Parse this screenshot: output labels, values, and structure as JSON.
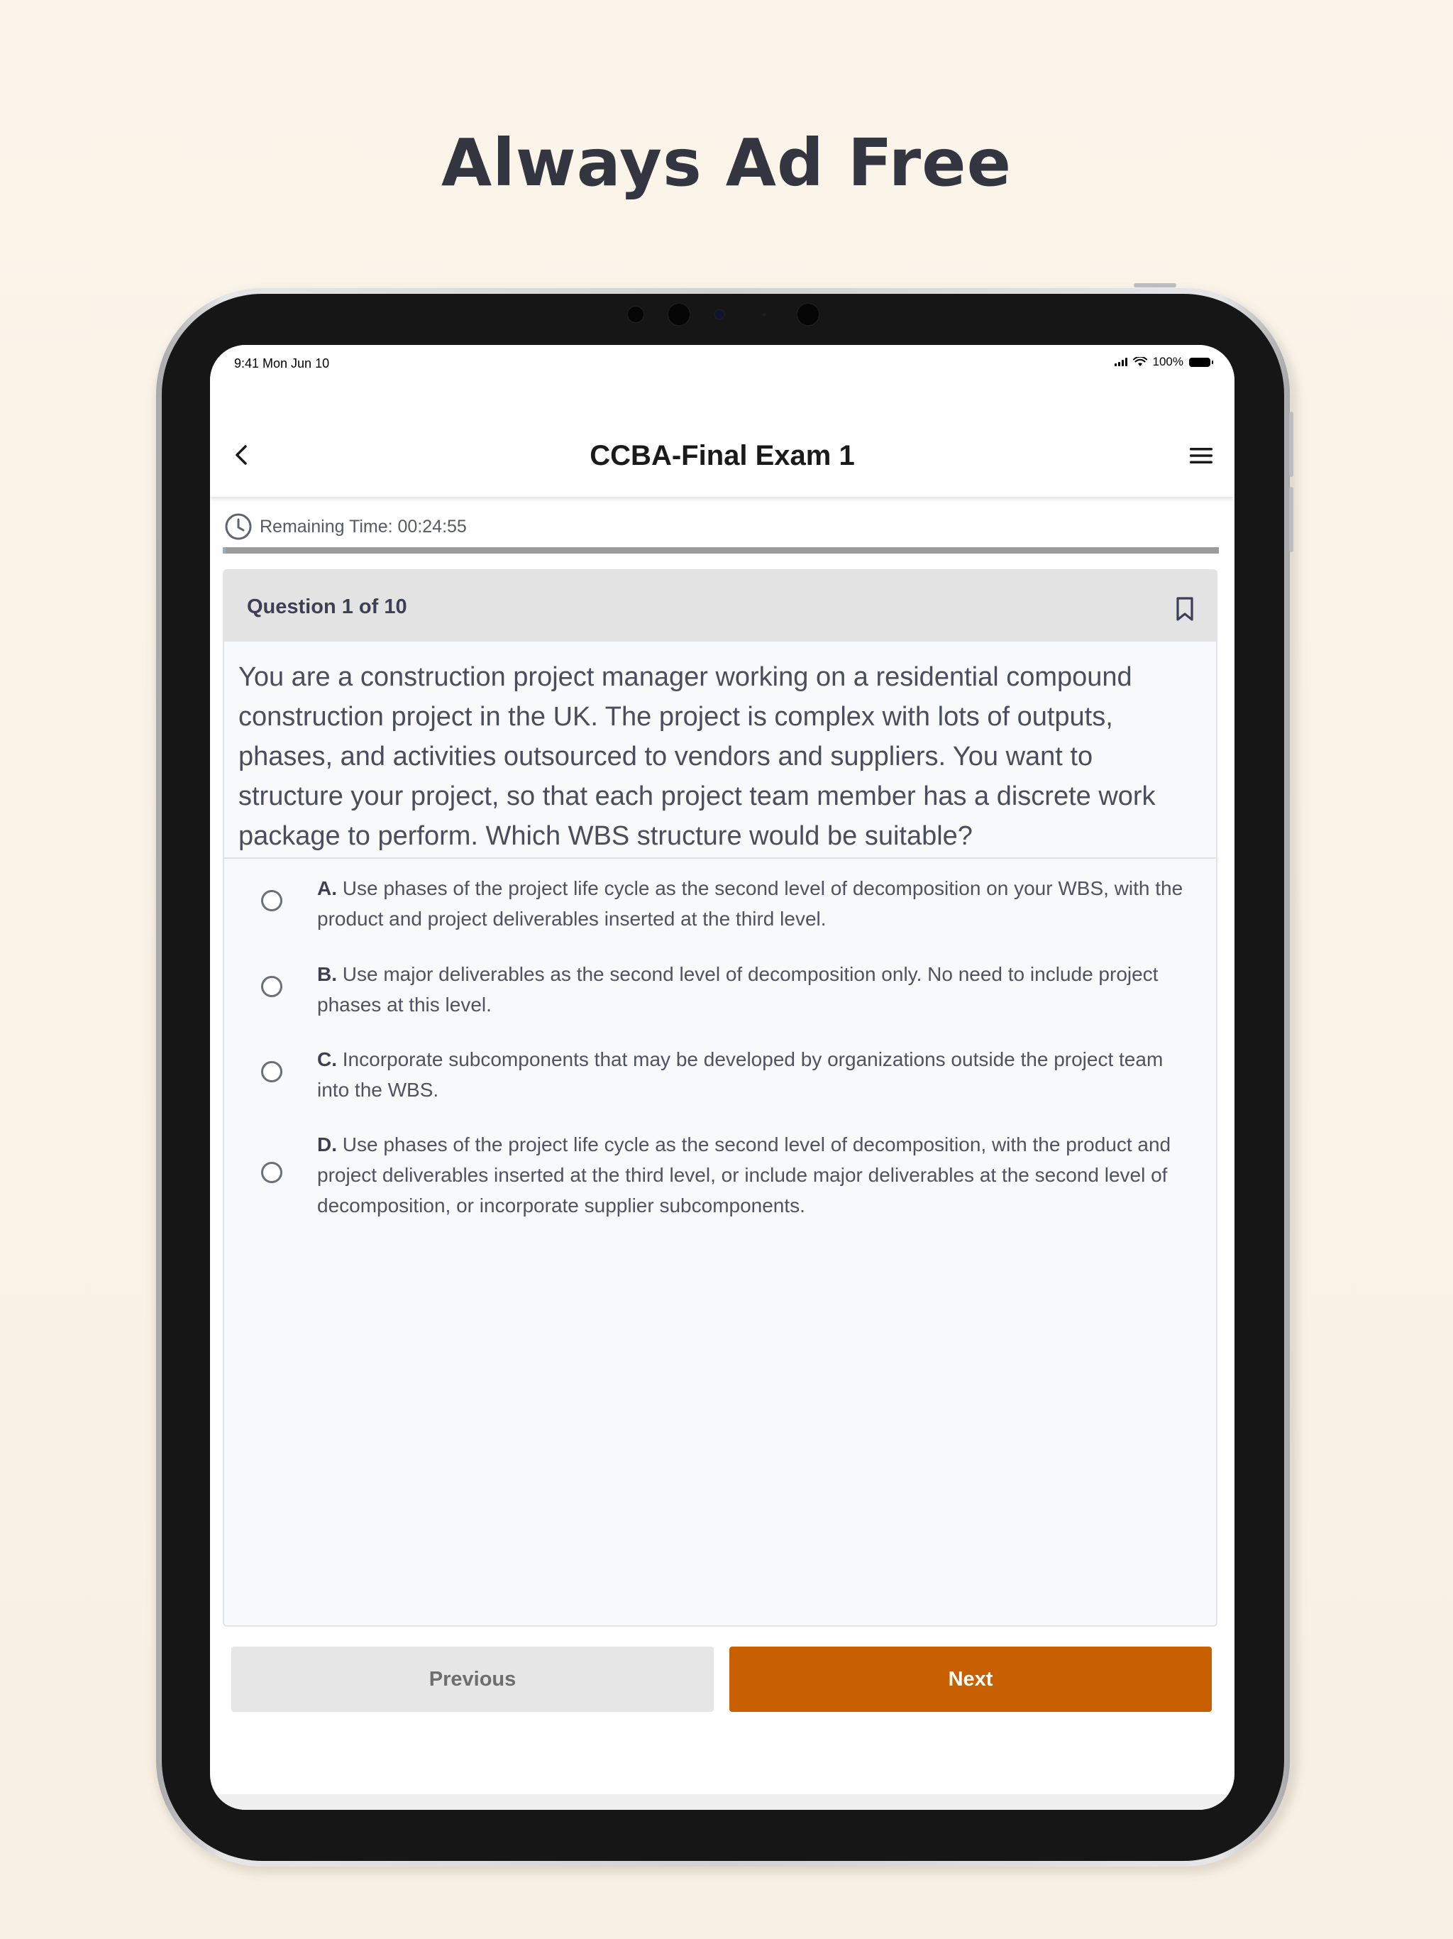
{
  "page": {
    "headline": "Always Ad Free"
  },
  "status_bar": {
    "time": "9:41  Mon Jun 10",
    "battery": "100%"
  },
  "navbar": {
    "title": "CCBA-Final Exam 1",
    "back_icon": "chevron-left-icon",
    "menu_icon": "hamburger-menu-icon"
  },
  "timer": {
    "label": "Remaining Time: 00:24:55",
    "icon": "clock-icon",
    "progress_fraction": 0.003
  },
  "question": {
    "counter": "Question 1 of 10",
    "bookmark_icon": "bookmark-icon",
    "text": "You are a construction project manager working on a residential compound construction project in the UK. The project is complex with lots of outputs, phases, and activities outsourced to vendors and suppliers. You want to structure your project, so that each project team member has a discrete work package to perform. Which WBS structure would be suitable?",
    "options": [
      {
        "letter": "A.",
        "text": "Use phases of the project life cycle as the second level of decomposition on your WBS, with the product and project deliverables inserted at the third level."
      },
      {
        "letter": "B.",
        "text": "Use major deliverables as the second level of decomposition only. No need to include project phases at this level."
      },
      {
        "letter": "C.",
        "text": "Incorporate subcomponents that may be developed by organizations outside the project team into the WBS."
      },
      {
        "letter": "D.",
        "text": "Use phases of the project life cycle as the second level of decomposition, with the product and project deliverables inserted at the third level, or include major deliverables at the second level of decomposition, or incorporate supplier subcomponents."
      }
    ]
  },
  "buttons": {
    "previous": "Previous",
    "next": "Next"
  },
  "colors": {
    "background": "#f9f2e6",
    "headline": "#333640",
    "next_button": "#c85f00",
    "previous_button": "#e6e6e6",
    "card_header": "#e3e3e3"
  }
}
